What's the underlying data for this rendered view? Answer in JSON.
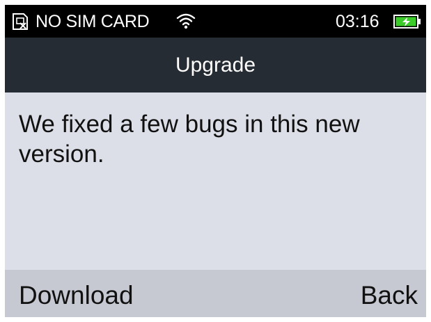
{
  "status_bar": {
    "sim_icon": "no-sim-icon",
    "sim_status": "NO SIM CARD",
    "wifi_icon": "wifi-icon",
    "time": "03:16",
    "battery_icon": "battery-charging-icon",
    "battery_color": "#3ccc2a"
  },
  "header": {
    "title": "Upgrade",
    "background": "#262c33"
  },
  "main": {
    "message": "We fixed a few bugs in this new version."
  },
  "softkeys": {
    "left_label": "Download",
    "right_label": "Back"
  }
}
